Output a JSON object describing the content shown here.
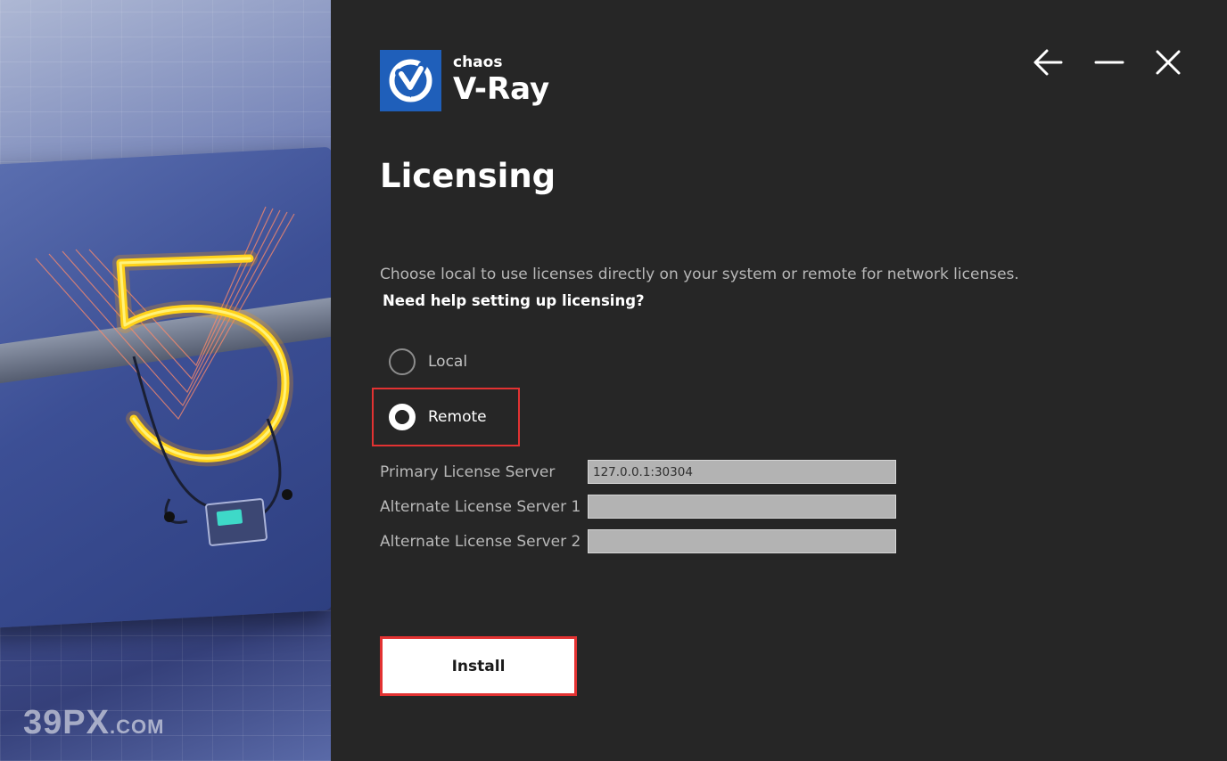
{
  "brand": {
    "company": "chaos",
    "product": "V-Ray",
    "logo_icon": "vray-v-logo-icon",
    "logo_color": "#1f5fba"
  },
  "window_controls": {
    "back_icon": "arrow-left-icon",
    "minimize_icon": "minimize-icon",
    "close_icon": "close-icon"
  },
  "page": {
    "title": "Licensing",
    "description": "Choose local to use licenses directly on your system or remote for network licenses.",
    "help_link": "Need help setting up licensing?"
  },
  "license_mode": {
    "options": [
      {
        "label": "Local",
        "selected": false
      },
      {
        "label": "Remote",
        "selected": true
      }
    ]
  },
  "servers": {
    "primary": {
      "label": "Primary License Server",
      "value": "127.0.0.1:30304"
    },
    "alternate1": {
      "label": "Alternate License Server 1",
      "value": ""
    },
    "alternate2": {
      "label": "Alternate License Server 2",
      "value": ""
    }
  },
  "actions": {
    "install_label": "Install"
  },
  "artwork": {
    "watermark_main": "39PX",
    "watermark_suffix": ".COM",
    "neon_color": "#ffb300"
  },
  "colors": {
    "background": "#262626",
    "highlight": "#e23232",
    "input_bg": "#b3b3b3"
  }
}
